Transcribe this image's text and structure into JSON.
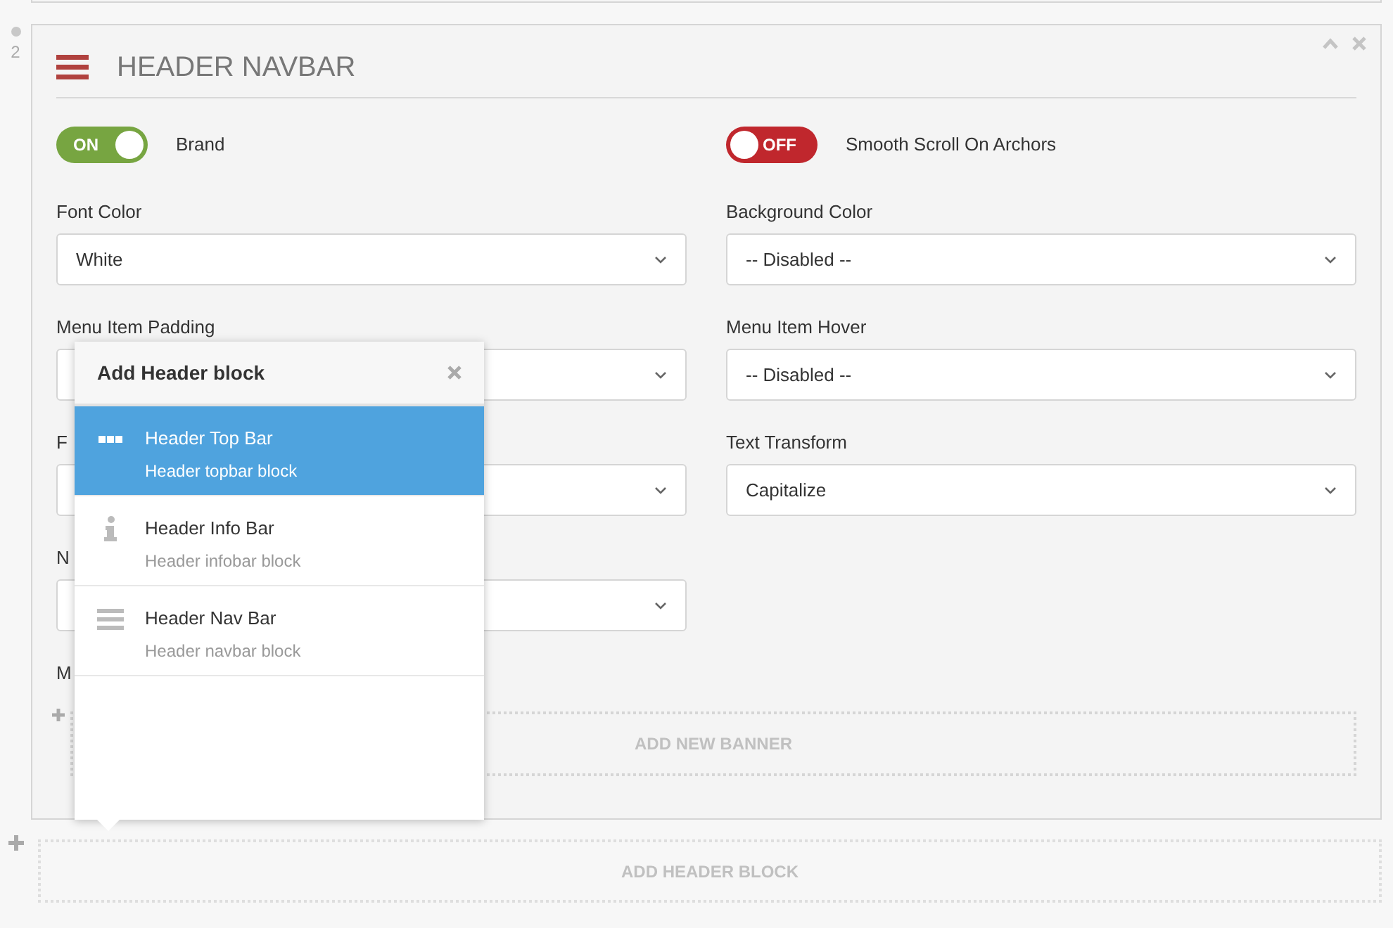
{
  "panel": {
    "number": "2",
    "title": "HEADER NAVBAR",
    "toggles": [
      {
        "label": "Brand",
        "on": true,
        "text": "ON"
      },
      {
        "label": "Smooth Scroll On Archors",
        "on": false,
        "text": "OFF"
      }
    ],
    "rows": [
      [
        {
          "kind": "select",
          "label": "Font Color",
          "value": "White"
        },
        {
          "kind": "select",
          "label": "Background Color",
          "value": "-- Disabled --"
        }
      ],
      [
        {
          "kind": "select",
          "label": "Menu Item Padding"
        },
        {
          "kind": "select",
          "label": "Menu Item Hover",
          "value": "-- Disabled --"
        }
      ],
      [
        {
          "kind": "select",
          "label": "F"
        },
        {
          "kind": "select",
          "label": "Text Transform",
          "value": "Capitalize"
        }
      ],
      [
        {
          "kind": "select",
          "label": "N"
        }
      ],
      [
        {
          "kind": "label",
          "label": "M"
        }
      ]
    ],
    "add_banner": "ADD NEW BANNER"
  },
  "popup": {
    "title": "Add Header block",
    "items": [
      {
        "kind": "dots",
        "title": "Header Top Bar",
        "subtitle": "Header topbar block",
        "selected": true
      },
      {
        "kind": "info",
        "title": "Header Info Bar",
        "subtitle": "Header infobar block",
        "selected": false
      },
      {
        "kind": "lines",
        "title": "Header Nav Bar",
        "subtitle": "Header navbar block",
        "selected": false
      }
    ]
  },
  "add_header": "ADD HEADER BLOCK"
}
